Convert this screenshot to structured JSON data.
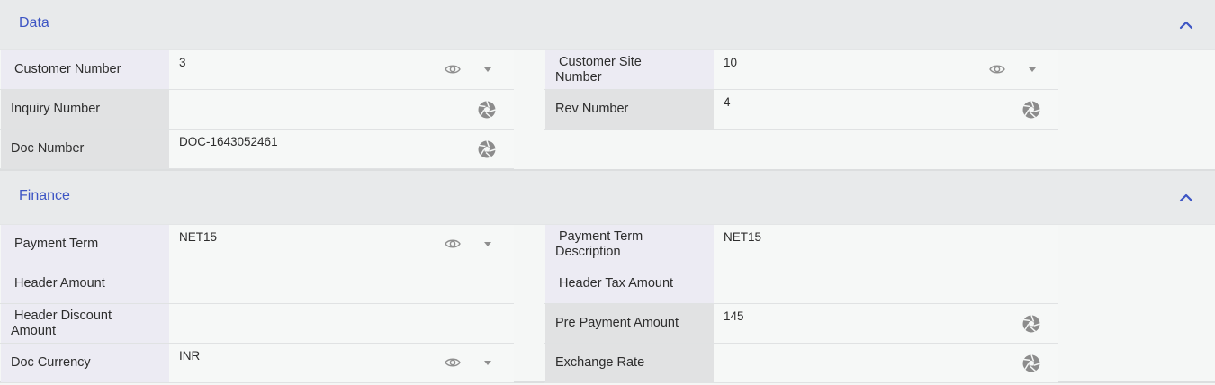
{
  "sections": {
    "data": {
      "title": "Data",
      "fields": {
        "customer_number": {
          "label": "Customer Number",
          "value": "3"
        },
        "customer_site_number": {
          "label_line1": "Customer Site",
          "label_line2": "Number",
          "value": "10"
        },
        "inquiry_number": {
          "label": "Inquiry Number",
          "value": ""
        },
        "rev_number": {
          "label": "Rev Number",
          "value": "4"
        },
        "doc_number": {
          "label": "Doc Number",
          "value": "DOC-1643052461"
        }
      }
    },
    "finance": {
      "title": "Finance",
      "fields": {
        "payment_term": {
          "label": "Payment Term",
          "value": "NET15"
        },
        "payment_term_description": {
          "label_line1": "Payment Term",
          "label_line2": "Description",
          "value": "NET15"
        },
        "header_amount": {
          "label": "Header Amount",
          "value": ""
        },
        "header_tax_amount": {
          "label": "Header Tax Amount",
          "value": ""
        },
        "header_discount_amount": {
          "label_line1": "Header Discount",
          "label_line2": "Amount",
          "value": ""
        },
        "pre_payment_amount": {
          "label": "Pre Payment Amount",
          "value": "145"
        },
        "doc_currency": {
          "label": "Doc Currency",
          "value": "INR"
        },
        "exchange_rate": {
          "label": "Exchange Rate",
          "value": ""
        }
      }
    }
  },
  "icons": {
    "collapse": "chevron-up-icon",
    "visibility": "eye-icon",
    "dropdown": "caret-down-icon",
    "generate": "aperture-icon"
  },
  "colors": {
    "accent": "#3d55c4",
    "header_bg": "#e8eaeb",
    "label_lavender": "#ecebf3",
    "label_grey": "#e1e2e3",
    "icon": "#8a8a8a"
  }
}
